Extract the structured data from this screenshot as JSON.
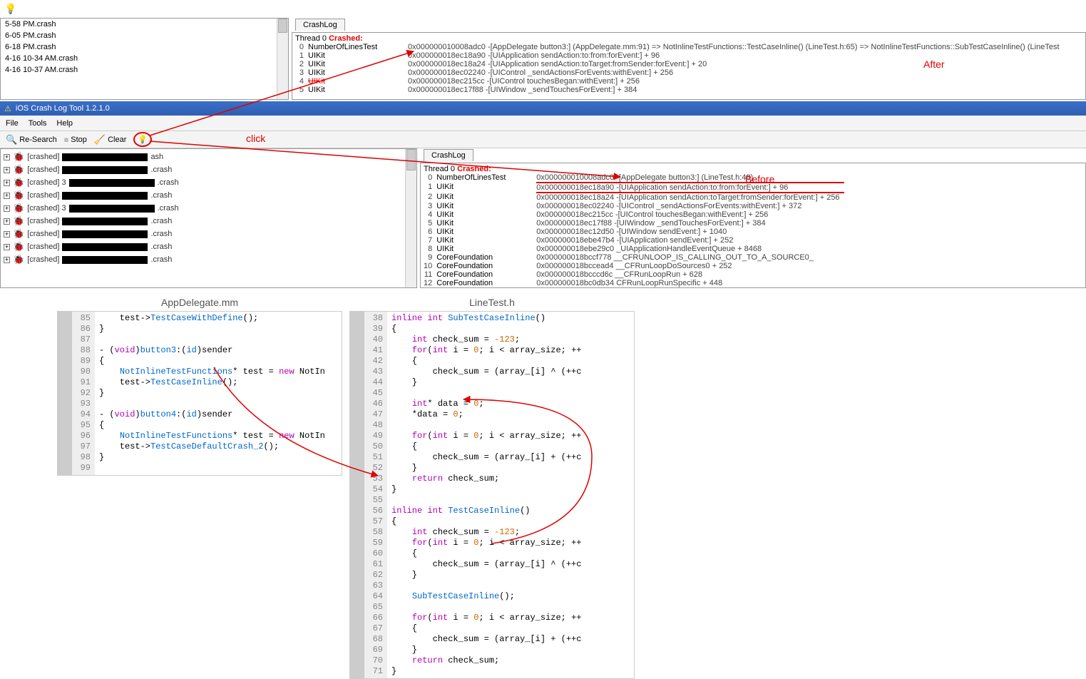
{
  "upperFileList": [
    "5-58 PM.crash",
    "6-05 PM.crash",
    "6-18 PM.crash",
    "4-16 10-34 AM.crash",
    "4-16 10-37 AM.crash"
  ],
  "tabLabel": "CrashLog",
  "afterLabel": "After",
  "beforeLabel": "Before",
  "clickLabel": "click",
  "crashHeader": {
    "thread": "Thread 0 ",
    "crashed": "Crashed:"
  },
  "afterStack": [
    {
      "idx": "0",
      "mod": "NumberOfLinesTest",
      "addr": "0x000000010008adc0 -[AppDelegate button3:] (AppDelegate.mm:91) => NotInlineTestFunctions::TestCaseInline() (LineTest.h:65) => NotInlineTestFunctions::SubTestCaseInline() (LineTest"
    },
    {
      "idx": "1",
      "mod": "UIKit",
      "addr": "0x000000018ec18a90 -[UIApplication sendAction:to:from:forEvent:] + 96"
    },
    {
      "idx": "2",
      "mod": "UIKit",
      "addr": "0x000000018ec18a24 -[UIApplication sendAction:toTarget:fromSender:forEvent:] + 20"
    },
    {
      "idx": "3",
      "mod": "UIKit",
      "addr": "0x000000018ec02240 -[UIControl _sendActionsForEvents:withEvent:] + 256"
    },
    {
      "idx": "4",
      "mod": "UIKit",
      "addr": "0x000000018ec215cc -[UIControl touchesBegan:withEvent:] + 256",
      "crossed": true
    },
    {
      "idx": "5",
      "mod": "UIKit",
      "addr": "0x000000018ec17f88 -[UIWindow _sendTouchesForEvent:] + 384"
    }
  ],
  "appTitle": "iOS Crash Log Tool 1.2.1.0",
  "menu": {
    "file": "File",
    "tools": "Tools",
    "help": "Help"
  },
  "toolbar": {
    "research": "Re-Search",
    "stop": "Stop",
    "clear": "Clear"
  },
  "treeItems": [
    {
      "pre": "[crashed] ",
      "suf": "ash"
    },
    {
      "pre": "[crashed] ",
      "suf": ".crash"
    },
    {
      "pre": "[crashed] 3",
      "suf": ".crash"
    },
    {
      "pre": "[crashed] ",
      "suf": ".crash"
    },
    {
      "pre": "[crashed] 3",
      "suf": ".crash"
    },
    {
      "pre": "[crashed] ",
      "suf": ".crash"
    },
    {
      "pre": "[crashed] ",
      "suf": ".crash"
    },
    {
      "pre": "[crashed] ",
      "suf": ".crash"
    },
    {
      "pre": "[crashed] ",
      "suf": ".crash"
    }
  ],
  "beforeStack": [
    {
      "idx": "0",
      "mod": "NumberOfLinesTest",
      "addr": "0x000000010008adc0 -[AppDelegate button3:] (LineTest.h:48)",
      "ul": true
    },
    {
      "idx": "1",
      "mod": "UIKit",
      "addr": "0x000000018ec18a90 -[UIApplication sendAction:to:from:forEvent:] + 96",
      "ul": true
    },
    {
      "idx": "2",
      "mod": "UIKit",
      "addr": "0x000000018ec18a24 -[UIApplication sendAction:toTarget:fromSender:forEvent:] + 256"
    },
    {
      "idx": "3",
      "mod": "UIKit",
      "addr": "0x000000018ec02240 -[UIControl _sendActionsForEvents:withEvent:] + 372"
    },
    {
      "idx": "4",
      "mod": "UIKit",
      "addr": "0x000000018ec215cc -[UIControl touchesBegan:withEvent:] + 256"
    },
    {
      "idx": "5",
      "mod": "UIKit",
      "addr": "0x000000018ec17f88 -[UIWindow _sendTouchesForEvent:] + 384"
    },
    {
      "idx": "6",
      "mod": "UIKit",
      "addr": "0x000000018ec12d50 -[UIWindow sendEvent:] + 1040"
    },
    {
      "idx": "7",
      "mod": "UIKit",
      "addr": "0x000000018ebe47b4 -[UIApplication sendEvent:] + 252"
    },
    {
      "idx": "8",
      "mod": "UIKit",
      "addr": "0x000000018ebe29c0 _UIApplicationHandleEventQueue + 8468"
    },
    {
      "idx": "9",
      "mod": "CoreFoundation",
      "addr": "0x000000018bccf778 __CFRUNLOOP_IS_CALLING_OUT_TO_A_SOURCE0_"
    },
    {
      "idx": "10",
      "mod": "CoreFoundation",
      "addr": "0x000000018bccead4 __CFRunLoopDoSources0 + 252"
    },
    {
      "idx": "11",
      "mod": "CoreFoundation",
      "addr": "0x000000018bcccd6c __CFRunLoopRun + 628"
    },
    {
      "idx": "12",
      "mod": "CoreFoundation",
      "addr": "0x000000018bc0db34 CFRunLoopRunSpecific + 448"
    }
  ],
  "src1": {
    "title": "AppDelegate.mm",
    "start": 85,
    "lines": [
      "    test->TestCaseWithDefine();",
      "}",
      "",
      "- (void)button3:(id)sender",
      "{",
      "    NotInlineTestFunctions* test = new NotIn",
      "    test->TestCaseInline();",
      "}",
      "",
      "- (void)button4:(id)sender",
      "{",
      "    NotInlineTestFunctions* test = new NotIn",
      "    test->TestCaseDefaultCrash_2();",
      "}",
      ""
    ]
  },
  "src2": {
    "title": "LineTest.h",
    "start": 38,
    "lines": [
      "inline int SubTestCaseInline()",
      "{",
      "    int check_sum = -123;",
      "    for(int i = 0; i < array_size; ++",
      "    {",
      "        check_sum = (array_[i] ^ (++c",
      "    }",
      "",
      "    int* data = 0;",
      "    *data = 0;",
      "",
      "    for(int i = 0; i < array_size; ++",
      "    {",
      "        check_sum = (array_[i] + (++c",
      "    }",
      "    return check_sum;",
      "}",
      "",
      "inline int TestCaseInline()",
      "{",
      "    int check_sum = -123;",
      "    for(int i = 0; i < array_size; ++",
      "    {",
      "        check_sum = (array_[i] ^ (++c",
      "    }",
      "",
      "    SubTestCaseInline();",
      "",
      "    for(int i = 0; i < array_size; ++",
      "    {",
      "        check_sum = (array_[i] + (++c",
      "    }",
      "    return check_sum;",
      "}"
    ]
  }
}
